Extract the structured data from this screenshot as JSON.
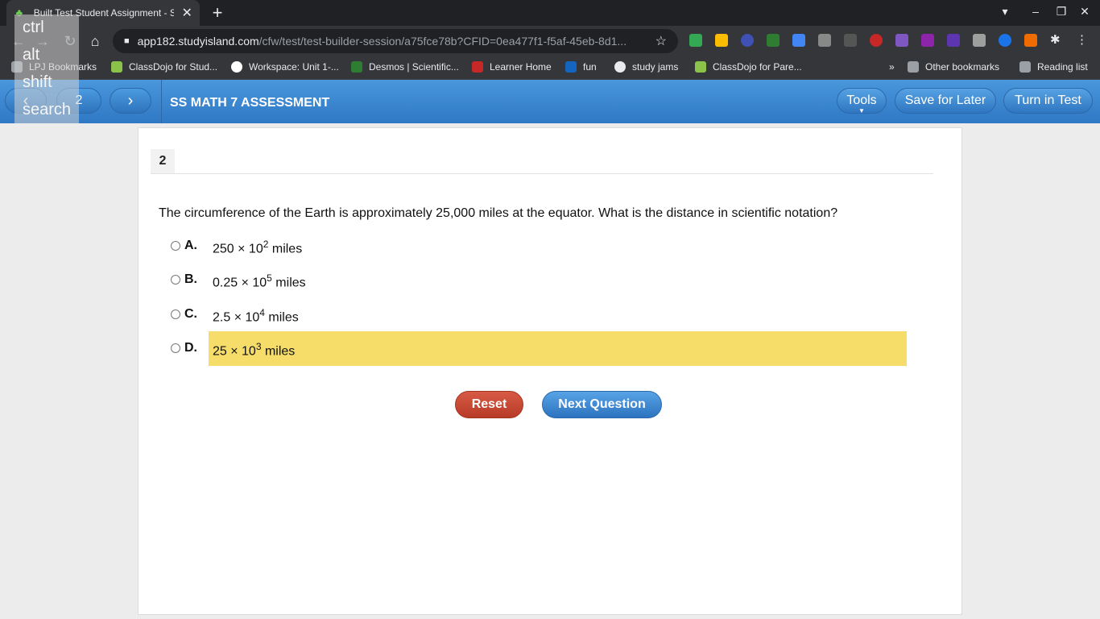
{
  "browser": {
    "tab_title": "Built Test Student Assignment - S",
    "url_host": "app182.studyisland.com",
    "url_path": "/cfw/test/test-builder-session/a75fce78b?CFID=0ea477f1-f5af-45eb-8d1...",
    "bookmarks": [
      "LPJ Bookmarks",
      "ClassDojo for Stud...",
      "Workspace: Unit 1-...",
      "Desmos | Scientific...",
      "Learner Home",
      "fun",
      "study jams",
      "ClassDojo for Pare..."
    ],
    "other_bookmarks": "Other bookmarks",
    "reading_list": "Reading list"
  },
  "keyboard_overlay": [
    "ctrl",
    "alt",
    "shift",
    "search"
  ],
  "header": {
    "question_number": "2",
    "title": "SS MATH 7 ASSESSMENT",
    "tools_label": "Tools",
    "save_label": "Save for Later",
    "turn_in_label": "Turn in Test"
  },
  "question": {
    "number": "2",
    "text": "The circumference of the Earth is approximately 25,000 miles at the equator. What is the distance in scientific notation?",
    "choices": [
      {
        "letter": "A.",
        "base": "250 × 10",
        "exp": "2",
        "unit": " miles"
      },
      {
        "letter": "B.",
        "base": "0.25 × 10",
        "exp": "5",
        "unit": " miles"
      },
      {
        "letter": "C.",
        "base": "2.5 × 10",
        "exp": "4",
        "unit": " miles"
      },
      {
        "letter": "D.",
        "base": "25 × 10",
        "exp": "3",
        "unit": " miles"
      }
    ]
  },
  "buttons": {
    "reset": "Reset",
    "next": "Next Question"
  }
}
